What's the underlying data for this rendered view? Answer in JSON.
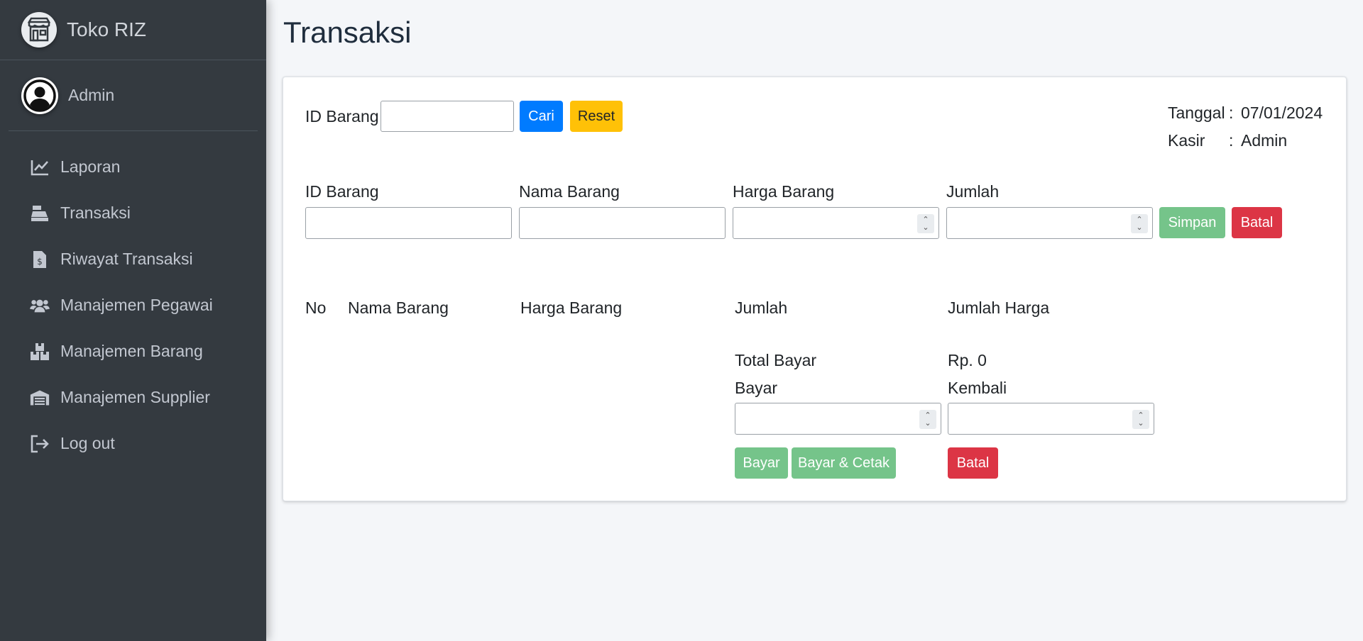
{
  "brand": {
    "name": "Toko RIZ",
    "logo_icon": "store-icon"
  },
  "user": {
    "name": "Admin",
    "avatar_icon": "user-circle-icon"
  },
  "nav": [
    {
      "label": "Laporan",
      "icon": "chart-line-icon"
    },
    {
      "label": "Transaksi",
      "icon": "cash-register-icon"
    },
    {
      "label": "Riwayat Transaksi",
      "icon": "receipt-icon"
    },
    {
      "label": "Manajemen Pegawai",
      "icon": "users-icon"
    },
    {
      "label": "Manajemen Barang",
      "icon": "boxes-icon"
    },
    {
      "label": "Manajemen Supplier",
      "icon": "warehouse-icon"
    },
    {
      "label": "Log out",
      "icon": "sign-out-icon"
    }
  ],
  "page": {
    "title": "Transaksi"
  },
  "search": {
    "label": "ID Barang",
    "value": "",
    "search_button": "Cari",
    "reset_button": "Reset"
  },
  "info": {
    "date_label": "Tanggal",
    "separator": ":",
    "date_value": "07/01/2024",
    "cashier_label": "Kasir",
    "cashier_value": "Admin"
  },
  "item_form": {
    "id_label": "ID Barang",
    "id_value": "",
    "name_label": "Nama Barang",
    "name_value": "",
    "price_label": "Harga Barang",
    "price_value": "",
    "qty_label": "Jumlah",
    "qty_value": "",
    "save_button": "Simpan",
    "cancel_button": "Batal"
  },
  "table": {
    "headers": [
      "No",
      "Nama Barang",
      "Harga Barang",
      "Jumlah",
      "Jumlah Harga"
    ],
    "rows": []
  },
  "payment": {
    "total_label": "Total Bayar",
    "total_value": "Rp. 0",
    "pay_label": "Bayar",
    "pay_value": "",
    "change_label": "Kembali",
    "change_value": "",
    "pay_button": "Bayar",
    "pay_print_button": "Bayar & Cetak",
    "cancel_button": "Batal"
  },
  "colors": {
    "sidebar_bg": "#343a40",
    "primary": "#007bff",
    "warning": "#ffc107",
    "success_light": "#75c48a",
    "danger": "#dc3545",
    "content_bg": "#f4f6f9"
  }
}
